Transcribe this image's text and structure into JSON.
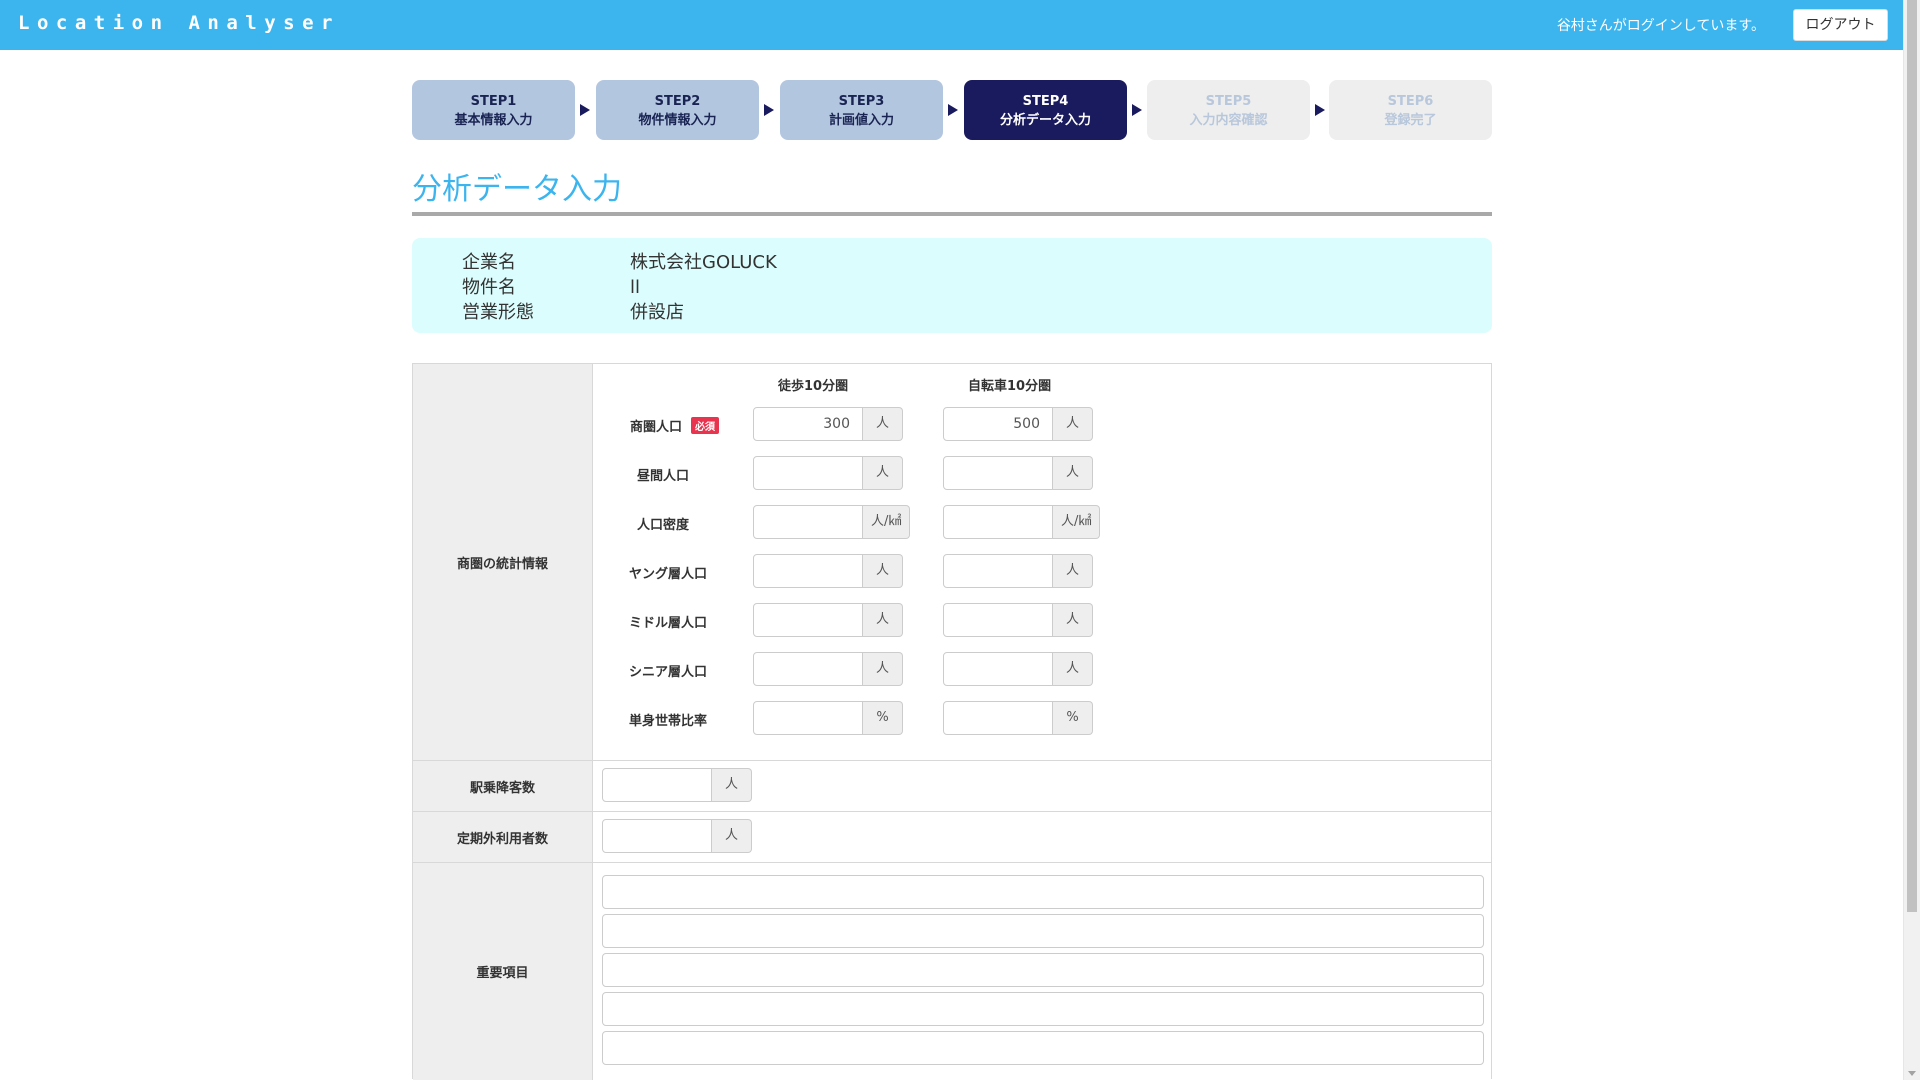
{
  "header": {
    "logo": "Location Analyser",
    "login_text": "谷村さんがログインしています。",
    "logout_label": "ログアウト"
  },
  "steps": [
    {
      "num": "STEP1",
      "label": "基本情報入力",
      "state": "done"
    },
    {
      "num": "STEP2",
      "label": "物件情報入力",
      "state": "done"
    },
    {
      "num": "STEP3",
      "label": "計画値入力",
      "state": "done"
    },
    {
      "num": "STEP4",
      "label": "分析データ入力",
      "state": "active"
    },
    {
      "num": "STEP5",
      "label": "入力内容確認",
      "state": "todo"
    },
    {
      "num": "STEP6",
      "label": "登録完了",
      "state": "todo"
    }
  ],
  "page_title": "分析データ入力",
  "info": {
    "company_label": "企業名",
    "company_value": "株式会社GOLUCK",
    "property_label": "物件名",
    "property_value": "ll",
    "business_label": "営業形態",
    "business_value": "併設店"
  },
  "form": {
    "stats_section_label": "商圏の統計情報",
    "col_walk": "徒歩10分圏",
    "col_bike": "自転車10分圏",
    "required_badge": "必須",
    "fields": [
      {
        "label": "商圏人口",
        "walk": "300",
        "bike": "500",
        "unit": "人",
        "required": true
      },
      {
        "label": "昼間人口",
        "walk": "",
        "bike": "",
        "unit": "人"
      },
      {
        "label": "人口密度",
        "walk": "",
        "bike": "",
        "unit": "人/㎢"
      },
      {
        "label": "ヤング層人口",
        "walk": "",
        "bike": "",
        "unit": "人"
      },
      {
        "label": "ミドル層人口",
        "walk": "",
        "bike": "",
        "unit": "人"
      },
      {
        "label": "シニア層人口",
        "walk": "",
        "bike": "",
        "unit": "人"
      },
      {
        "label": "単身世帯比率",
        "walk": "",
        "bike": "",
        "unit": "%"
      }
    ],
    "station_label": "駅乗降客数",
    "station_value": "",
    "station_unit": "人",
    "non_commuter_label": "定期外利用者数",
    "non_commuter_value": "",
    "non_commuter_unit": "人",
    "important_label": "重要項目",
    "important_items": [
      "",
      "",
      "",
      "",
      ""
    ]
  }
}
